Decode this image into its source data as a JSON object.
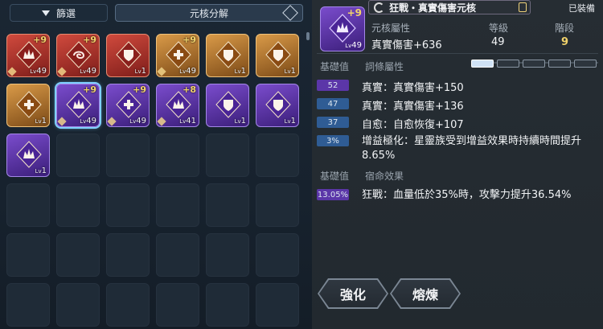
{
  "tabs": {
    "filter_label": "篩選",
    "decompose_label": "元核分解"
  },
  "inventory": [
    {
      "frame": "red",
      "plus": "+9",
      "lv": "49",
      "kind": "crown",
      "pip": true
    },
    {
      "frame": "red",
      "plus": "+9",
      "lv": "49",
      "kind": "swirl",
      "pip": true
    },
    {
      "frame": "red",
      "plus": "",
      "lv": "1",
      "kind": "shield",
      "pip": false
    },
    {
      "frame": "orange",
      "plus": "+9",
      "lv": "49",
      "kind": "cross",
      "pip": true
    },
    {
      "frame": "orange",
      "plus": "",
      "lv": "1",
      "kind": "shield",
      "pip": false
    },
    {
      "frame": "orange",
      "plus": "",
      "lv": "1",
      "kind": "shield",
      "pip": false
    },
    {
      "frame": "orange",
      "plus": "",
      "lv": "1",
      "kind": "cross",
      "pip": false
    },
    {
      "frame": "purple",
      "plus": "+9",
      "lv": "49",
      "kind": "crown",
      "pip": true,
      "selected": true
    },
    {
      "frame": "purple",
      "plus": "+9",
      "lv": "49",
      "kind": "cross",
      "pip": true
    },
    {
      "frame": "purple",
      "plus": "+8",
      "lv": "41",
      "kind": "crown",
      "pip": true
    },
    {
      "frame": "purple",
      "plus": "",
      "lv": "1",
      "kind": "shield",
      "pip": false
    },
    {
      "frame": "purple",
      "plus": "",
      "lv": "1",
      "kind": "shield",
      "pip": false
    },
    {
      "frame": "purple",
      "plus": "",
      "lv": "1",
      "kind": "crown",
      "pip": false
    }
  ],
  "detail": {
    "title": "狂戰・真實傷害元核",
    "equipped_label": "已裝備",
    "icon": {
      "plus": "+9",
      "lv": "49"
    },
    "header_labels": {
      "attr": "元核屬性",
      "level": "等級",
      "stage": "階段"
    },
    "header_values": {
      "attr": "真實傷害+636",
      "level": "49",
      "stage": "9"
    },
    "section1": {
      "base_label": "基礎值",
      "attr_label": "詞條屬性"
    },
    "stats": [
      {
        "badge": "52",
        "color": "purple",
        "text": "真實：真實傷害+150"
      },
      {
        "badge": "47",
        "color": "blue",
        "text": "真實：真實傷害+136"
      },
      {
        "badge": "37",
        "color": "blue",
        "text": "自愈：自愈恢復+107"
      },
      {
        "badge": "3%",
        "color": "blue",
        "text": "增益極化：星靈族受到增益效果時持續時間提升8.65%"
      }
    ],
    "section2": {
      "base_label": "基礎值",
      "effect_label": "宿命效果"
    },
    "fate": {
      "badge": "13.05%",
      "text": "狂戰：血量低於35%時，攻擊力提升36.54%"
    },
    "buttons": {
      "enhance": "強化",
      "refine": "熔煉"
    }
  }
}
